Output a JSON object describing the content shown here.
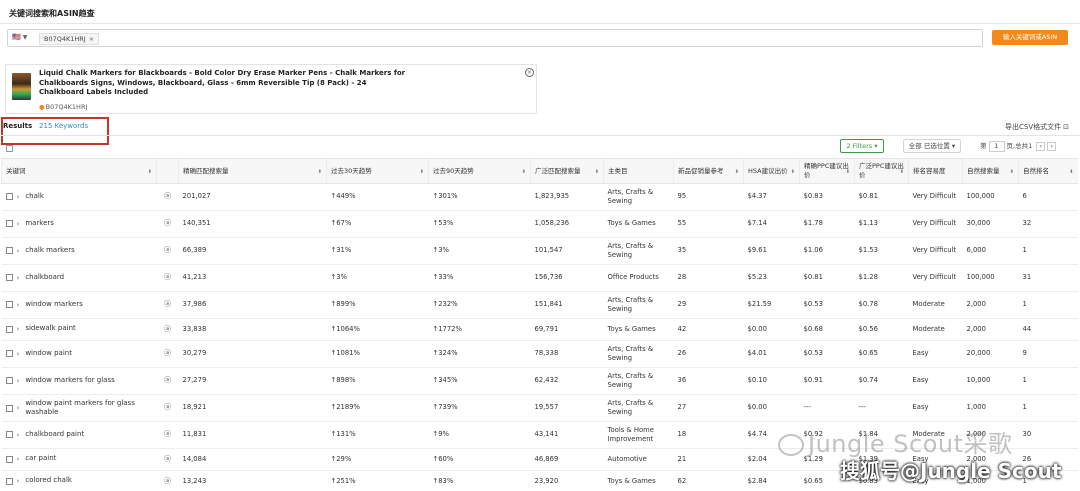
{
  "header": {
    "title": "关键词搜索和ASIN趋查"
  },
  "search": {
    "market": "🇺🇸",
    "asin_chip": "B07Q4K1HRJ",
    "submit_label": "输入关键词或ASIN"
  },
  "product": {
    "title": "Liquid Chalk Markers for Blackboards - Bold Color Dry Erase Marker Pens - Chalk Markers for Chalkboards Signs, Windows, Blackboard, Glass - 6mm Reversible Tip (8 Pack) - 24 Chalkboard Labels Included",
    "asin": "B07Q4K1HRJ"
  },
  "results": {
    "tab_label": "Results",
    "count_label": "215 Keywords",
    "export_label": "导出CSV格式文件",
    "filters_label": "2 Filters",
    "select_label": "全部 已选位置",
    "pager_prefix": "第",
    "page": "1",
    "pager_suffix": "页,总共1"
  },
  "table": {
    "columns": [
      "关键词",
      "",
      "精确匹配搜索量",
      "过去30天趋势",
      "过去90天趋势",
      "广泛匹配搜索量",
      "主类目",
      "新品促销量参考",
      "HSA建议出价",
      "精确PPC建议出价",
      "广泛PPC建议出价",
      "排名容易度",
      "自然搜索量",
      "自然排名"
    ],
    "rows": [
      {
        "keyword": "chalk",
        "exact": "201,027",
        "t30": "↑449%",
        "t90": "↑301%",
        "broad": "1,823,935",
        "category": "Arts, Crafts & Sewing",
        "giveaways": "95",
        "hsa": "$4.37",
        "exact_ppc": "$0.83",
        "broad_ppc": "$0.81",
        "ease": "Very Difficult",
        "organic": "100,000",
        "rank": "6"
      },
      {
        "keyword": "markers",
        "exact": "140,351",
        "t30": "↑67%",
        "t90": "↑53%",
        "broad": "1,058,236",
        "category": "Toys & Games",
        "giveaways": "55",
        "hsa": "$7.14",
        "exact_ppc": "$1.78",
        "broad_ppc": "$1.13",
        "ease": "Very Difficult",
        "organic": "30,000",
        "rank": "32"
      },
      {
        "keyword": "chalk markers",
        "exact": "66,389",
        "t30": "↑31%",
        "t90": "↑3%",
        "broad": "101,547",
        "category": "Arts, Crafts & Sewing",
        "giveaways": "35",
        "hsa": "$9.61",
        "exact_ppc": "$1.06",
        "broad_ppc": "$1.53",
        "ease": "Very Difficult",
        "organic": "6,000",
        "rank": "1"
      },
      {
        "keyword": "chalkboard",
        "exact": "41,213",
        "t30": "↑3%",
        "t90": "↑33%",
        "broad": "156,736",
        "category": "Office Products",
        "giveaways": "28",
        "hsa": "$5.23",
        "exact_ppc": "$0.81",
        "broad_ppc": "$1.28",
        "ease": "Very Difficult",
        "organic": "100,000",
        "rank": "31"
      },
      {
        "keyword": "window markers",
        "exact": "37,986",
        "t30": "↑899%",
        "t90": "↑232%",
        "broad": "151,841",
        "category": "Arts, Crafts & Sewing",
        "giveaways": "29",
        "hsa": "$21.59",
        "exact_ppc": "$0.53",
        "broad_ppc": "$0.78",
        "ease": "Moderate",
        "organic": "2,000",
        "rank": "1"
      },
      {
        "keyword": "sidewalk paint",
        "exact": "33,838",
        "t30": "↑1064%",
        "t90": "↑1772%",
        "broad": "69,791",
        "category": "Toys & Games",
        "giveaways": "42",
        "hsa": "$0.00",
        "exact_ppc": "$0.68",
        "broad_ppc": "$0.56",
        "ease": "Moderate",
        "organic": "2,000",
        "rank": "44"
      },
      {
        "keyword": "window paint",
        "exact": "30,279",
        "t30": "↑1081%",
        "t90": "↑324%",
        "broad": "78,338",
        "category": "Arts, Crafts & Sewing",
        "giveaways": "26",
        "hsa": "$4.01",
        "exact_ppc": "$0.53",
        "broad_ppc": "$0.65",
        "ease": "Easy",
        "organic": "20,000",
        "rank": "9"
      },
      {
        "keyword": "window markers for glass",
        "exact": "27,279",
        "t30": "↑898%",
        "t90": "↑345%",
        "broad": "62,432",
        "category": "Arts, Crafts & Sewing",
        "giveaways": "36",
        "hsa": "$0.10",
        "exact_ppc": "$0.91",
        "broad_ppc": "$0.74",
        "ease": "Easy",
        "organic": "10,000",
        "rank": "1"
      },
      {
        "keyword": "window paint markers for glass washable",
        "exact": "18,921",
        "t30": "↑2189%",
        "t90": "↑739%",
        "broad": "19,557",
        "category": "Arts, Crafts & Sewing",
        "giveaways": "27",
        "hsa": "$0.00",
        "exact_ppc": "---",
        "broad_ppc": "---",
        "ease": "Easy",
        "organic": "1,000",
        "rank": "1"
      },
      {
        "keyword": "chalkboard paint",
        "exact": "11,831",
        "t30": "↑131%",
        "t90": "↑9%",
        "broad": "43,141",
        "category": "Tools & Home Improvement",
        "giveaways": "18",
        "hsa": "$4.74",
        "exact_ppc": "$0.92",
        "broad_ppc": "$1.84",
        "ease": "Moderate",
        "organic": "2,000",
        "rank": "30"
      },
      {
        "keyword": "car paint",
        "exact": "14,084",
        "t30": "↑29%",
        "t90": "↑60%",
        "broad": "46,869",
        "category": "Automotive",
        "giveaways": "21",
        "hsa": "$2.04",
        "exact_ppc": "$1.29",
        "broad_ppc": "$1.39",
        "ease": "Easy",
        "organic": "2,000",
        "rank": "26"
      },
      {
        "keyword": "colored chalk",
        "exact": "13,243",
        "t30": "↑251%",
        "t90": "↑83%",
        "broad": "23,920",
        "category": "Toys & Games",
        "giveaways": "62",
        "hsa": "$2.84",
        "exact_ppc": "$0.65",
        "broad_ppc": "$0.83",
        "ease": "Easy",
        "organic": "1,000",
        "rank": "1"
      }
    ]
  },
  "watermarks": {
    "line1": "Jungle Scout采歌",
    "line2": "搜狐号@Jungle Scout"
  }
}
